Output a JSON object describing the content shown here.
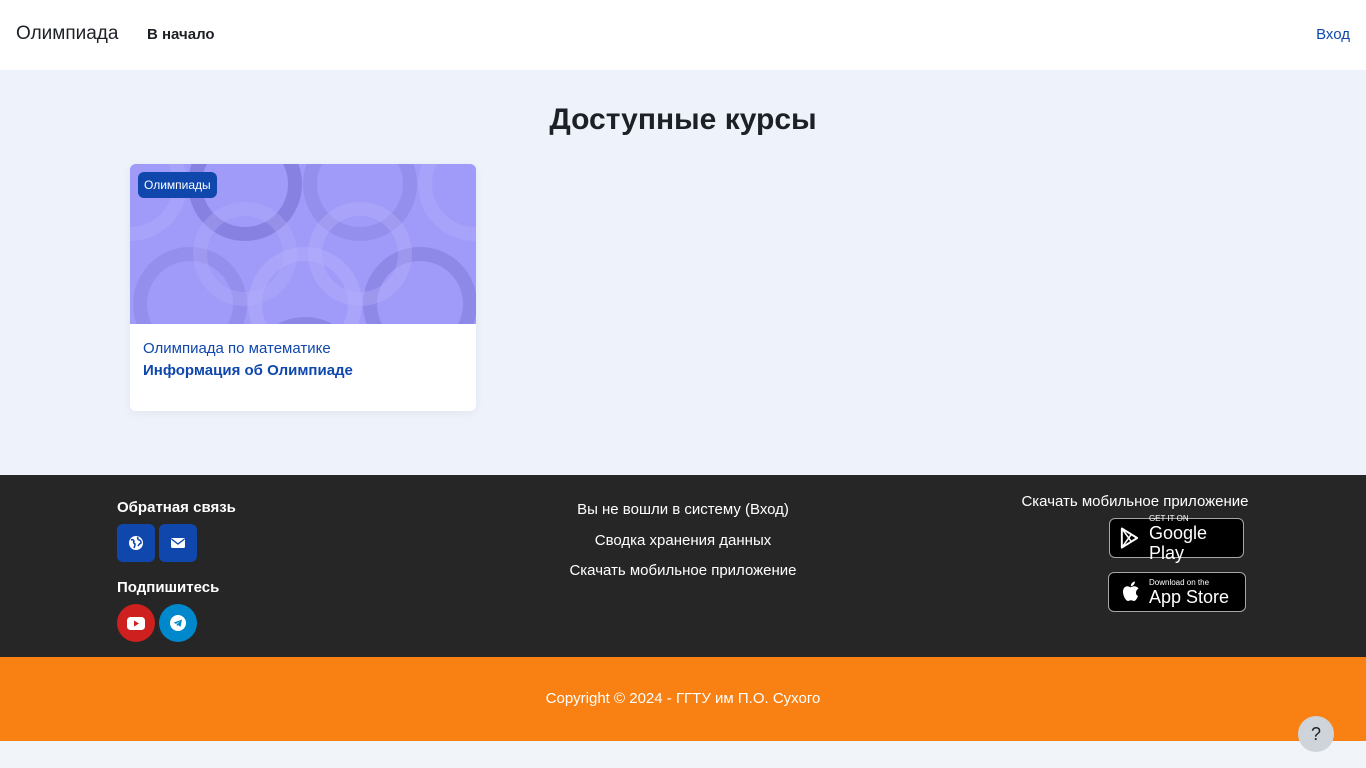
{
  "navbar": {
    "brand": "Олимпиада",
    "home_label": "В начало",
    "login_label": "Вход"
  },
  "main": {
    "title": "Доступные курсы",
    "courses": [
      {
        "badge": "Олимпиады",
        "category": "Олимпиада по математике",
        "name": "Информация об Олимпиаде"
      }
    ]
  },
  "footer": {
    "feedback_title": "Обратная связь",
    "feedback_icons": [
      "globe-icon",
      "envelope-icon"
    ],
    "subscribe_title": "Подпишитесь",
    "subscribe_icons": [
      "youtube-icon",
      "telegram-icon"
    ],
    "links": [
      "Вы не вошли в систему (Вход)",
      "Сводка хранения данных",
      "Скачать мобильное приложение"
    ],
    "apps_title": "Скачать мобильное приложение",
    "google_play": {
      "small": "GET IT ON",
      "big": "Google Play"
    },
    "app_store": {
      "small": "Download on the",
      "big": "App Store"
    },
    "copyright": "Copyright © 2024 - ГГТУ им П.О. Сухого"
  },
  "help": {
    "label": "?"
  },
  "colors": {
    "brand_blue": "#0f47ad",
    "footer_dark": "#262626",
    "footer_orange": "#f98012",
    "youtube_red": "#cd201f",
    "telegram_blue": "#0088cc",
    "course_image": "#a09bf8"
  }
}
